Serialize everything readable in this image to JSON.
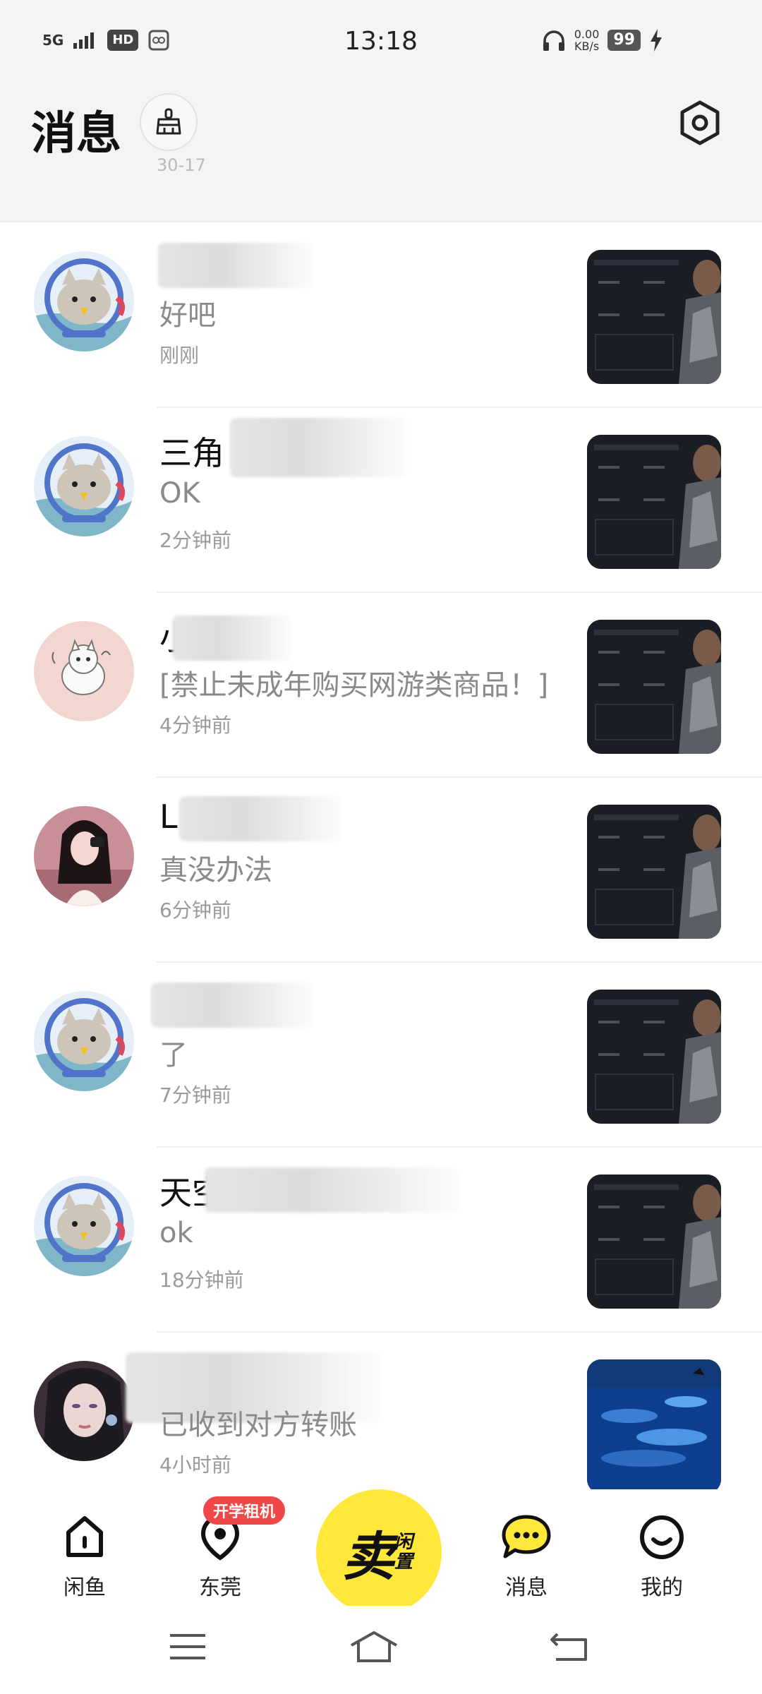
{
  "status_bar": {
    "signal": "5G",
    "hd": "HD",
    "time": "13:18",
    "net_speed_value": "0.00",
    "net_speed_unit": "KB/s",
    "battery": "99"
  },
  "header": {
    "title": "消息",
    "partial_text": "30-17"
  },
  "conversations": [
    {
      "name": "",
      "last_message": "好吧",
      "time": "刚刚"
    },
    {
      "name": "三角",
      "last_message": "OK",
      "time": "2分钟前"
    },
    {
      "name": "小猫",
      "last_message": "[禁止未成年购买网游类商品！]",
      "time": "4分钟前"
    },
    {
      "name": "L",
      "last_message": "真没办法",
      "time": "6分钟前"
    },
    {
      "name": "",
      "last_message": "了",
      "time": "7分钟前"
    },
    {
      "name": "天空",
      "last_message": "ok",
      "time": "18分钟前"
    },
    {
      "name": "",
      "last_message": "已收到对方转账",
      "time": "4小时前"
    }
  ],
  "bottom_nav": {
    "home": "闲鱼",
    "city": "东莞",
    "city_badge": "开学租机",
    "sell_main": "卖",
    "sell_sub": "闲置",
    "messages": "消息",
    "mine": "我的"
  },
  "colors": {
    "accent_yellow": "#ffe83a",
    "badge_red": "#f04848"
  }
}
